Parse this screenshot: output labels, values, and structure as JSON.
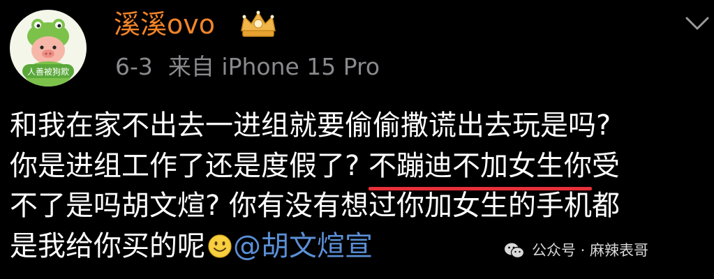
{
  "avatar": {
    "caption": "人善被狗欺"
  },
  "header": {
    "username": "溪溪ovo",
    "date": "6-3",
    "source": "来自 iPhone 15 Pro"
  },
  "icons": {
    "badge": "crown-badge-icon",
    "expand": "chevron-down-icon",
    "emoji": "smiley-emoji-icon",
    "watermark": "wechat-icon"
  },
  "post": {
    "line1": "和我在家不出去一进组就要偷偷撒谎出去玩是吗?",
    "line2_part1": "你是进组工作了还是度假了? ",
    "line2_highlight": "不蹦迪不加女生你",
    "line2_part2": "受",
    "line3": "不了是吗胡文煊? 你有没有想过你加女生的手机都",
    "line4": "是我给你买的呢",
    "mention": "@胡文煊宣"
  },
  "watermark": {
    "text": "公众号 · 麻辣表哥"
  },
  "colors": {
    "background": "#000000",
    "username": "#f3842a",
    "meta": "#8a8a8e",
    "mention": "#5b8fd6",
    "underline": "#e8303a"
  }
}
